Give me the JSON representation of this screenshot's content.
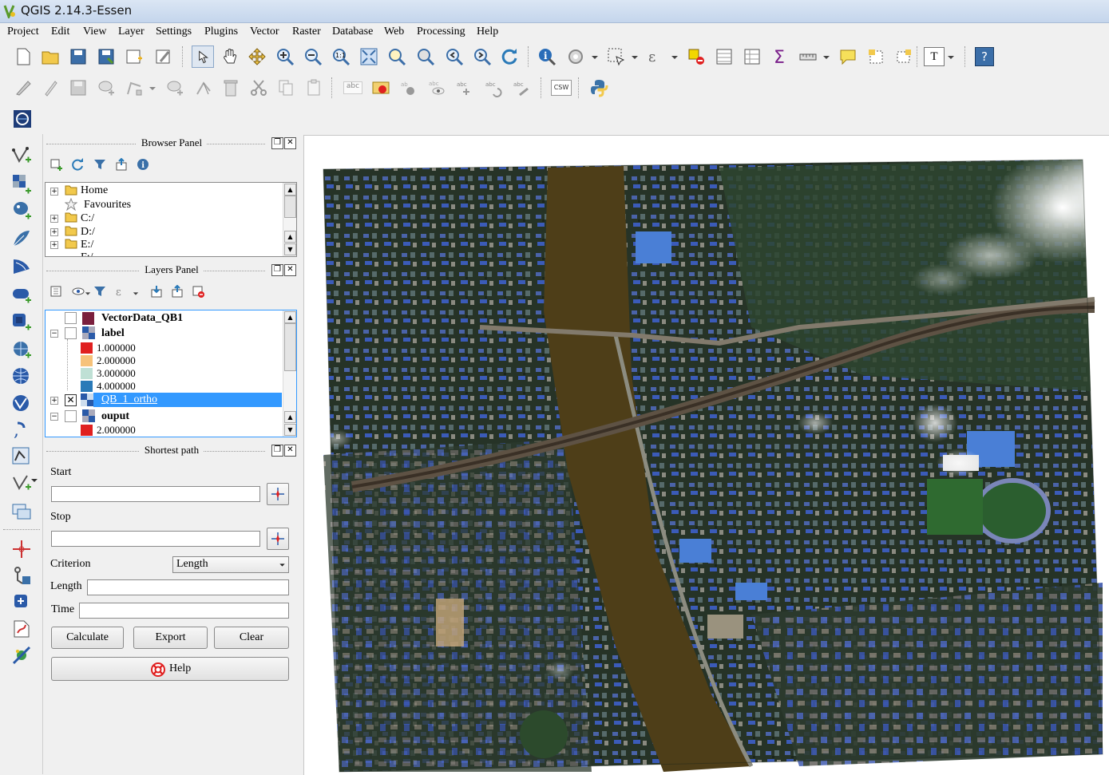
{
  "window": {
    "title": "QGIS 2.14.3-Essen"
  },
  "menu": [
    "Project",
    "Edit",
    "View",
    "Layer",
    "Settings",
    "Plugins",
    "Vector",
    "Raster",
    "Database",
    "Web",
    "Processing",
    "Help"
  ],
  "toolbar": {
    "csw_label": "CSW",
    "abc_label": "abc",
    "help_label": "?",
    "text_label": "T"
  },
  "browser_panel": {
    "title": "Browser Panel",
    "items": [
      "Home",
      "Favourites",
      "C:/",
      "D:/",
      "E:/",
      "F:/"
    ]
  },
  "layers_panel": {
    "title": "Layers Panel",
    "layers": [
      {
        "name": "VectorData_QB1",
        "checked": false,
        "color": "#7a1f3d"
      },
      {
        "name": "label",
        "checked": false
      },
      {
        "name": "QB_1_ortho",
        "checked": true,
        "selected": true
      },
      {
        "name": "ouput",
        "checked": false
      }
    ],
    "legend_label": [
      {
        "value": "1.000000",
        "color": "#e02020"
      },
      {
        "value": "2.000000",
        "color": "#f6c27a"
      },
      {
        "value": "3.000000",
        "color": "#bfe0d5"
      },
      {
        "value": "4.000000",
        "color": "#2a7ab8"
      }
    ],
    "legend_ouput": [
      {
        "value": "2.000000",
        "color": "#e02020"
      }
    ]
  },
  "shortest_path": {
    "title": "Shortest path",
    "start_label": "Start",
    "stop_label": "Stop",
    "criterion_label": "Criterion",
    "criterion_value": "Length",
    "length_label": "Length",
    "time_label": "Time",
    "calculate_label": "Calculate",
    "export_label": "Export",
    "clear_label": "Clear",
    "help_label": "Help"
  },
  "colors": {
    "selection": "#3399ff",
    "water": "#4e3e18",
    "urban": "#2b3a2a"
  }
}
